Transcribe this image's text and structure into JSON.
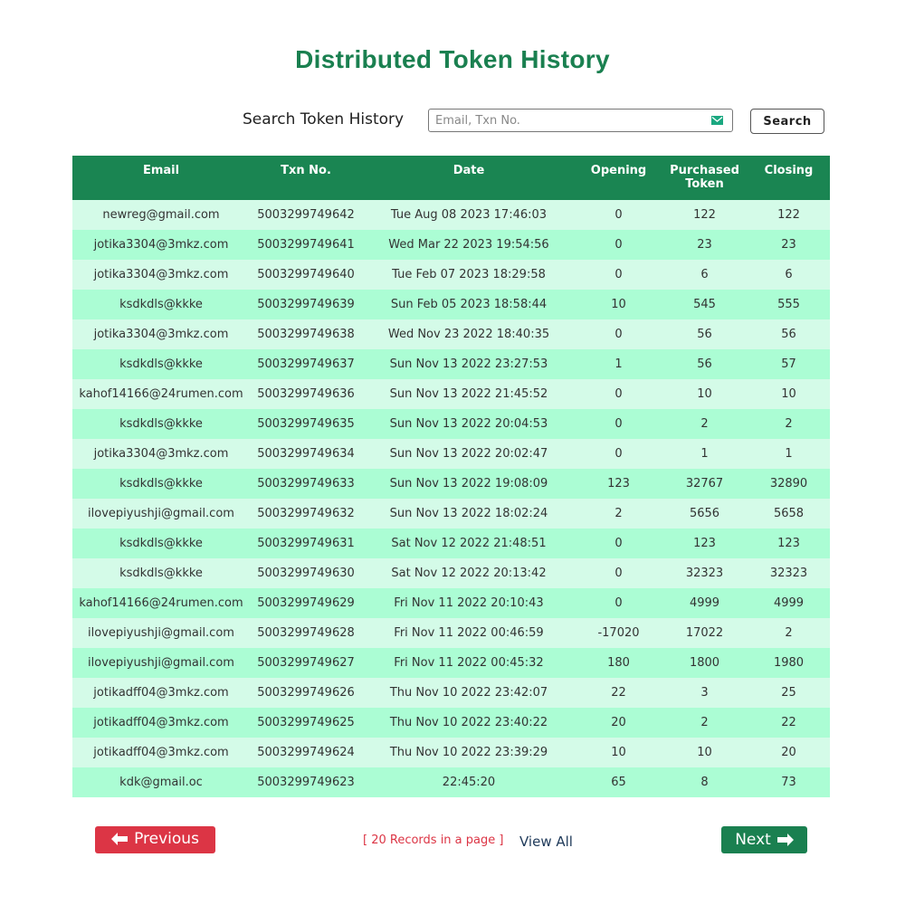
{
  "page": {
    "title": "Distributed Token History"
  },
  "search": {
    "label": "Search Token History",
    "placeholder": "Email, Txn No.",
    "value": "",
    "button_label": "Search",
    "icon": "envelope-icon"
  },
  "table": {
    "columns": [
      "Email",
      "Txn No.",
      "Date",
      "Opening",
      "Purchased Token",
      "Closing"
    ],
    "rows": [
      [
        "newreg@gmail.com",
        "5003299749642",
        "Tue Aug 08 2023 17:46:03",
        "0",
        "122",
        "122"
      ],
      [
        "jotika3304@3mkz.com",
        "5003299749641",
        "Wed Mar 22 2023 19:54:56",
        "0",
        "23",
        "23"
      ],
      [
        "jotika3304@3mkz.com",
        "5003299749640",
        "Tue Feb 07 2023 18:29:58",
        "0",
        "6",
        "6"
      ],
      [
        "ksdkdls@kkke",
        "5003299749639",
        "Sun Feb 05 2023 18:58:44",
        "10",
        "545",
        "555"
      ],
      [
        "jotika3304@3mkz.com",
        "5003299749638",
        "Wed Nov 23 2022 18:40:35",
        "0",
        "56",
        "56"
      ],
      [
        "ksdkdls@kkke",
        "5003299749637",
        "Sun Nov 13 2022 23:27:53",
        "1",
        "56",
        "57"
      ],
      [
        "kahof14166@24rumen.com",
        "5003299749636",
        "Sun Nov 13 2022 21:45:52",
        "0",
        "10",
        "10"
      ],
      [
        "ksdkdls@kkke",
        "5003299749635",
        "Sun Nov 13 2022 20:04:53",
        "0",
        "2",
        "2"
      ],
      [
        "jotika3304@3mkz.com",
        "5003299749634",
        "Sun Nov 13 2022 20:02:47",
        "0",
        "1",
        "1"
      ],
      [
        "ksdkdls@kkke",
        "5003299749633",
        "Sun Nov 13 2022 19:08:09",
        "123",
        "32767",
        "32890"
      ],
      [
        "ilovepiyushji@gmail.com",
        "5003299749632",
        "Sun Nov 13 2022 18:02:24",
        "2",
        "5656",
        "5658"
      ],
      [
        "ksdkdls@kkke",
        "5003299749631",
        "Sat Nov 12 2022 21:48:51",
        "0",
        "123",
        "123"
      ],
      [
        "ksdkdls@kkke",
        "5003299749630",
        "Sat Nov 12 2022 20:13:42",
        "0",
        "32323",
        "32323"
      ],
      [
        "kahof14166@24rumen.com",
        "5003299749629",
        "Fri Nov 11 2022 20:10:43",
        "0",
        "4999",
        "4999"
      ],
      [
        "ilovepiyushji@gmail.com",
        "5003299749628",
        "Fri Nov 11 2022 00:46:59",
        "-17020",
        "17022",
        "2"
      ],
      [
        "ilovepiyushji@gmail.com",
        "5003299749627",
        "Fri Nov 11 2022 00:45:32",
        "180",
        "1800",
        "1980"
      ],
      [
        "jotikadff04@3mkz.com",
        "5003299749626",
        "Thu Nov 10 2022 23:42:07",
        "22",
        "3",
        "25"
      ],
      [
        "jotikadff04@3mkz.com",
        "5003299749625",
        "Thu Nov 10 2022 23:40:22",
        "20",
        "2",
        "22"
      ],
      [
        "jotikadff04@3mkz.com",
        "5003299749624",
        "Thu Nov 10 2022 23:39:29",
        "10",
        "10",
        "20"
      ],
      [
        "kdk@gmail.oc",
        "5003299749623",
        "22:45:20",
        "65",
        "8",
        "73"
      ]
    ]
  },
  "pagination": {
    "previous_label": "Previous",
    "previous_icon": "arrow-left-icon",
    "records_text": "[ 20 Records in a page ]",
    "view_all_label": "View All",
    "next_label": "Next",
    "next_icon": "arrow-right-icon"
  },
  "colors": {
    "title": "#1a8050",
    "table_header": "#1a8552",
    "row_light": "#d4fbe8",
    "row_mint": "#abfdd4",
    "previous_button": "#dc3545",
    "next_button": "#1a8050",
    "records_text": "#dc3545"
  }
}
